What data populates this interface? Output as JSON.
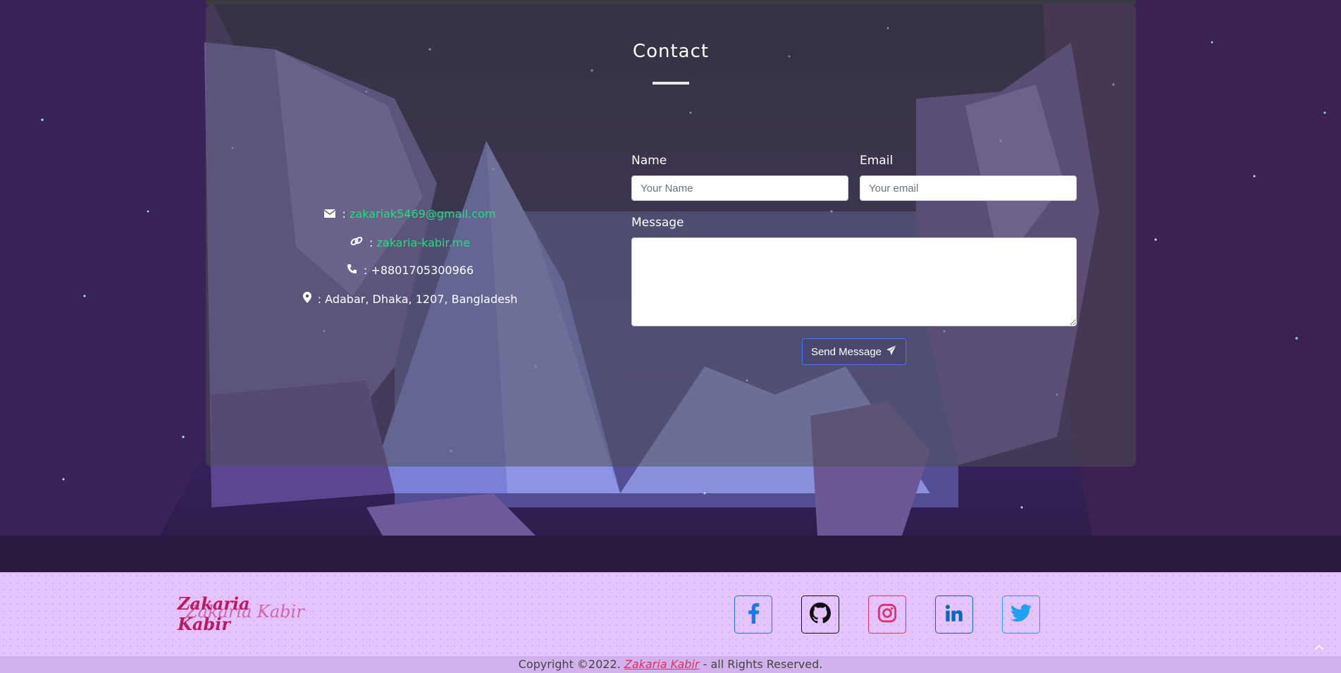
{
  "contact": {
    "title": "Contact",
    "email": "zakariak5469@gmail.com",
    "website": "zakaria-kabir.me",
    "phone": "+8801705300966",
    "address": "Adabar, Dhaka, 1207, Bangladesh",
    "separator": ":"
  },
  "form": {
    "name_label": "Name",
    "name_placeholder": "Your Name",
    "email_label": "Email",
    "email_placeholder": "Your email",
    "message_label": "Message",
    "send_label": "Send Message"
  },
  "footer": {
    "logo_text": "Zakaria Kabir",
    "social": [
      {
        "icon": "facebook-icon",
        "color": "#1877f2"
      },
      {
        "icon": "github-icon",
        "color": "#111111"
      },
      {
        "icon": "instagram-icon",
        "color": "#e1306c"
      },
      {
        "icon": "linkedin-icon",
        "color": "#0a66c2"
      },
      {
        "icon": "twitter-icon",
        "color": "#1da1f2"
      }
    ],
    "copyright_prefix": "Copyright ©2022.",
    "copyright_name": "Zakaria Kabir",
    "copyright_suffix": "- all Rights Reserved."
  },
  "colors": {
    "link_green": "#1ee07a",
    "footer_bg": "#e4c3ff",
    "accent_pink": "#c2185b"
  }
}
